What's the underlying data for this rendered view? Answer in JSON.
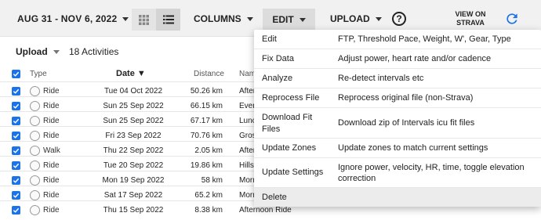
{
  "toolbar": {
    "date_range": "AUG 31 - NOV 6, 2022",
    "columns_label": "COLUMNS",
    "edit_label": "EDIT",
    "upload_label": "UPLOAD",
    "help_symbol": "?",
    "view_on_strava_line1": "VIEW ON",
    "view_on_strava_line2": "STRAVA",
    "icons": [
      "grid-view-icon",
      "list-view-icon",
      "help-icon",
      "refresh-icon"
    ],
    "accent_color": "#1a73e8"
  },
  "subbar": {
    "upload_label": "Upload",
    "activities_count": "18 Activities"
  },
  "table": {
    "columns": {
      "type": "Type",
      "date": "Date",
      "date_sort_glyph": "▼",
      "distance": "Distance",
      "name": "Name"
    },
    "rows": [
      {
        "type": "Ride",
        "date": "Tue 04 Oct 2022",
        "distance": "50.26 km",
        "name": "After"
      },
      {
        "type": "Ride",
        "date": "Sun 25 Sep 2022",
        "distance": "66.15 km",
        "name": "Even"
      },
      {
        "type": "Ride",
        "date": "Sun 25 Sep 2022",
        "distance": "67.17 km",
        "name": "Lunc"
      },
      {
        "type": "Ride",
        "date": "Fri 23 Sep 2022",
        "distance": "70.76 km",
        "name": "Gross"
      },
      {
        "type": "Walk",
        "date": "Thu 22 Sep 2022",
        "distance": "2.05 km",
        "name": "After"
      },
      {
        "type": "Ride",
        "date": "Tue 20 Sep 2022",
        "distance": "19.86 km",
        "name": "Hills"
      },
      {
        "type": "Ride",
        "date": "Mon 19 Sep 2022",
        "distance": "58 km",
        "name": "Morn"
      },
      {
        "type": "Ride",
        "date": "Sat 17 Sep 2022",
        "distance": "65.2 km",
        "name": "Morn"
      },
      {
        "type": "Ride",
        "date": "Thu 15 Sep 2022",
        "distance": "8.38 km",
        "name": "Afternoon Ride"
      }
    ]
  },
  "edit_menu": {
    "items": [
      {
        "label": "Edit",
        "description": "FTP, Threshold Pace, Weight, W', Gear, Type"
      },
      {
        "label": "Fix Data",
        "description": "Adjust power, heart rate and/or cadence"
      },
      {
        "label": "Analyze",
        "description": "Re-detect intervals etc"
      },
      {
        "label": "Reprocess File",
        "description": "Reprocess original file (non-Strava)"
      },
      {
        "label": "Download Fit Files",
        "description": "Download zip of Intervals icu fit files"
      },
      {
        "label": "Update Zones",
        "description": "Update zones to match current settings"
      },
      {
        "label": "Update Settings",
        "description": "Ignore power, velocity, HR, time, toggle elevation correction"
      },
      {
        "label": "Delete",
        "description": ""
      }
    ]
  }
}
